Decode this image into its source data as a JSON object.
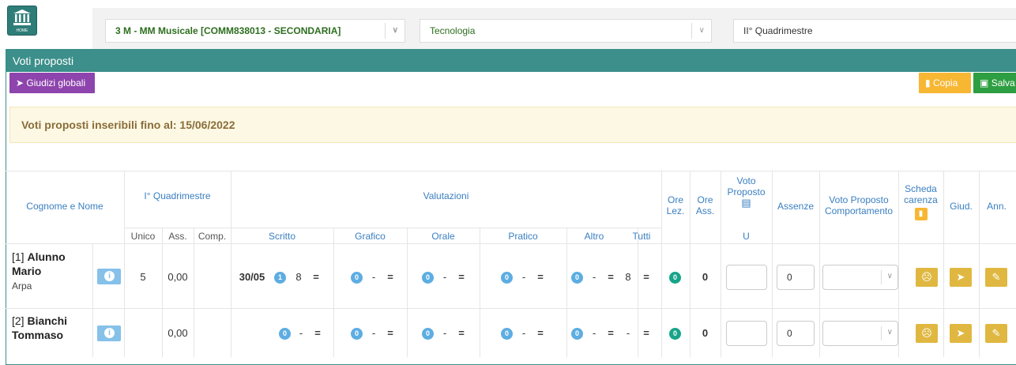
{
  "topbar": {
    "home_label": "HOME",
    "class_select": "3 M - MM Musicale [COMM838013 - SECONDARIA]",
    "subject_select": "Tecnologia",
    "period_select": "II° Quadrimestre"
  },
  "panel": {
    "title": "Voti proposti",
    "btn_giudizi": "Giudizi globali",
    "btn_copia": "Copia",
    "btn_salva": "Salva",
    "alert": "Voti proposti inseribili fino al: 15/06/2022"
  },
  "header": {
    "cognome_nome": "Cognome e Nome",
    "quadrimestre": "I° Quadrimestre",
    "valutazioni": "Valutazioni",
    "ore_lez": "Ore Lez.",
    "ore_ass": "Ore Ass.",
    "voto_proposto": "Voto Proposto",
    "assenze": "Assenze",
    "voto_comp": "Voto Proposto Comportamento",
    "scheda_carenza": "Scheda carenza",
    "giud": "Giud.",
    "ann": "Ann.",
    "unico": "Unico",
    "ass": "Ass.",
    "comp": "Comp.",
    "scritto": "Scritto",
    "grafico": "Grafico",
    "orale": "Orale",
    "pratico": "Pratico",
    "altro": "Altro",
    "tutti": "Tutti",
    "u": "U"
  },
  "rows": [
    {
      "num": "[1]",
      "name": "Alunno Mario",
      "sub": "Arpa",
      "unico": "5",
      "ass": "0,00",
      "scritto_date": "30/05",
      "scritto_count": "1",
      "scritto_avg": "8",
      "grafico_count": "0",
      "grafico_avg": "-",
      "orale_count": "0",
      "orale_avg": "-",
      "pratico_count": "0",
      "pratico_avg": "-",
      "altro_count": "0",
      "altro_avg": "-",
      "tutti_avg": "8",
      "ore_lez": "0",
      "ore_ass": "0",
      "assenze": "0",
      "eq": "="
    },
    {
      "num": "[2]",
      "name": "Bianchi Tommaso",
      "sub": "",
      "unico": "",
      "ass": "0,00",
      "scritto_date": "",
      "scritto_count": "0",
      "scritto_avg": "-",
      "grafico_count": "0",
      "grafico_avg": "-",
      "orale_count": "0",
      "orale_avg": "-",
      "pratico_count": "0",
      "pratico_avg": "-",
      "altro_count": "0",
      "altro_avg": "-",
      "tutti_avg": "-",
      "ore_lez": "0",
      "ore_ass": "0",
      "assenze": "0",
      "eq": "="
    }
  ],
  "colors": {
    "teal": "#3c8f8a",
    "purple": "#8e44ad",
    "orange": "#f7b733",
    "green": "#2d9e41",
    "header_text": "#3a7fc1",
    "yellow_btn": "#e0b841"
  }
}
